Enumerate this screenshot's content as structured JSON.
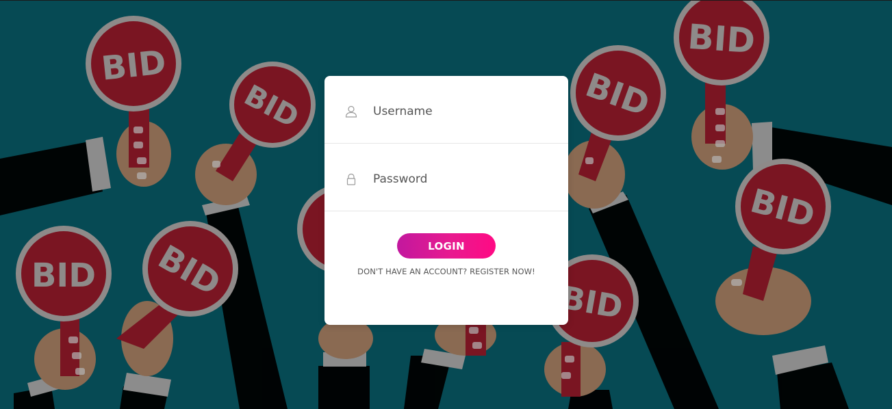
{
  "background": {
    "color": "#064a54",
    "paddle_label": "BID",
    "paddle_color": "#7a1522",
    "sleeve_color": "#000000",
    "hand_color": "#8a6a52"
  },
  "login_form": {
    "username": {
      "placeholder": "Username",
      "icon": "user-icon"
    },
    "password": {
      "placeholder": "Password",
      "icon": "lock-icon"
    },
    "login_label": "LOGIN",
    "register_label": "DON'T HAVE AN ACCOUNT? REGISTER NOW!",
    "accent_colors": [
      "#c2189e",
      "#ff0a84"
    ]
  }
}
